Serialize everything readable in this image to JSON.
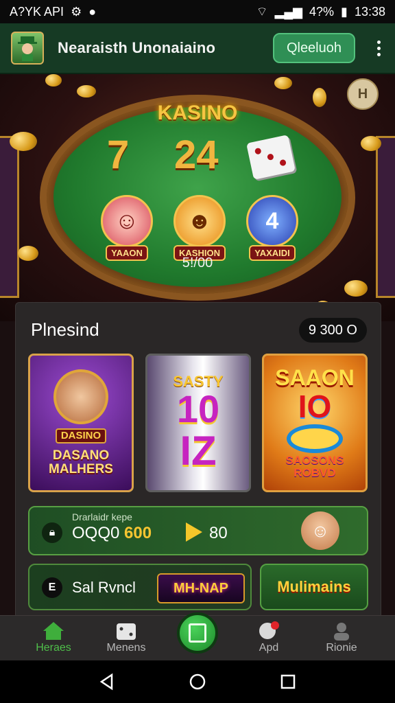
{
  "status_bar": {
    "left_text": "A?YK API",
    "battery": "4?%",
    "time": "13:38"
  },
  "app_bar": {
    "title": "Nearaisth Unonaiaino",
    "action_label": "Qleeluoh"
  },
  "hero": {
    "badge": "KASINO",
    "reel_symbols": [
      "7",
      "24"
    ],
    "emblems": [
      {
        "label": "YAAON"
      },
      {
        "label": "KASHION"
      },
      {
        "label": "YAXAIDI"
      }
    ],
    "emblem_glyphs": [
      "☺",
      "☻",
      "4"
    ],
    "count": "5!/00",
    "corner_icon": "H"
  },
  "panel": {
    "title": "Plnesind",
    "balance": "9 300 O",
    "cards": [
      {
        "top": "DASINO",
        "bottom": "DASANO MALHERS"
      },
      {
        "top": "SASTY",
        "mid": "10",
        "bottom": "IZ"
      },
      {
        "top": "SAAON",
        "mid": "IO",
        "bottom": "SAOSONS ROBVD"
      }
    ],
    "promo": {
      "subtitle": "Drarlaidr kepe",
      "amount_prefix": "OQQ0",
      "amount_value": "600",
      "amount2": "80"
    },
    "btn_left": {
      "icon_text": "E",
      "label": "Sal Rvncl",
      "logo": "MH-NAP"
    },
    "btn_right": {
      "label": "Mulimains"
    }
  },
  "bottom_nav": [
    {
      "label": "Heraes",
      "icon": "home-icon"
    },
    {
      "label": "Menens",
      "icon": "dice-icon"
    },
    {
      "label": "Apd",
      "icon": "chat-icon"
    },
    {
      "label": "Rionie",
      "icon": "people-icon"
    }
  ],
  "colors": {
    "accent_green": "#2f8f55",
    "gold": "#f6c542"
  }
}
